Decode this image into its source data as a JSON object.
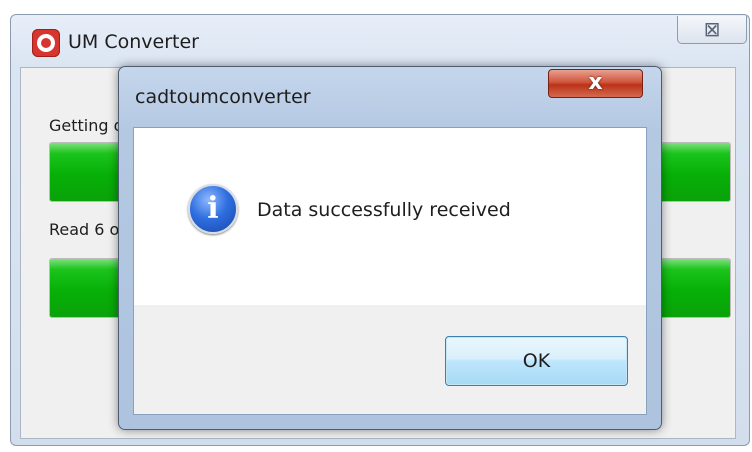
{
  "main_window": {
    "title": "UM Converter",
    "icon": "um-converter-app-icon",
    "close_glyph": "⊠",
    "status_line_1": "Getting data from CAD",
    "status_line_2": "Read 6 objects",
    "progress_1": 1.0,
    "progress_2": 1.0,
    "progress_color": "#07b007"
  },
  "dialog": {
    "title": "cadtoumconverter",
    "close_glyph": "x",
    "icon": "information-icon",
    "icon_glyph": "i",
    "message": "Data successfully received",
    "ok_label": "OK"
  }
}
